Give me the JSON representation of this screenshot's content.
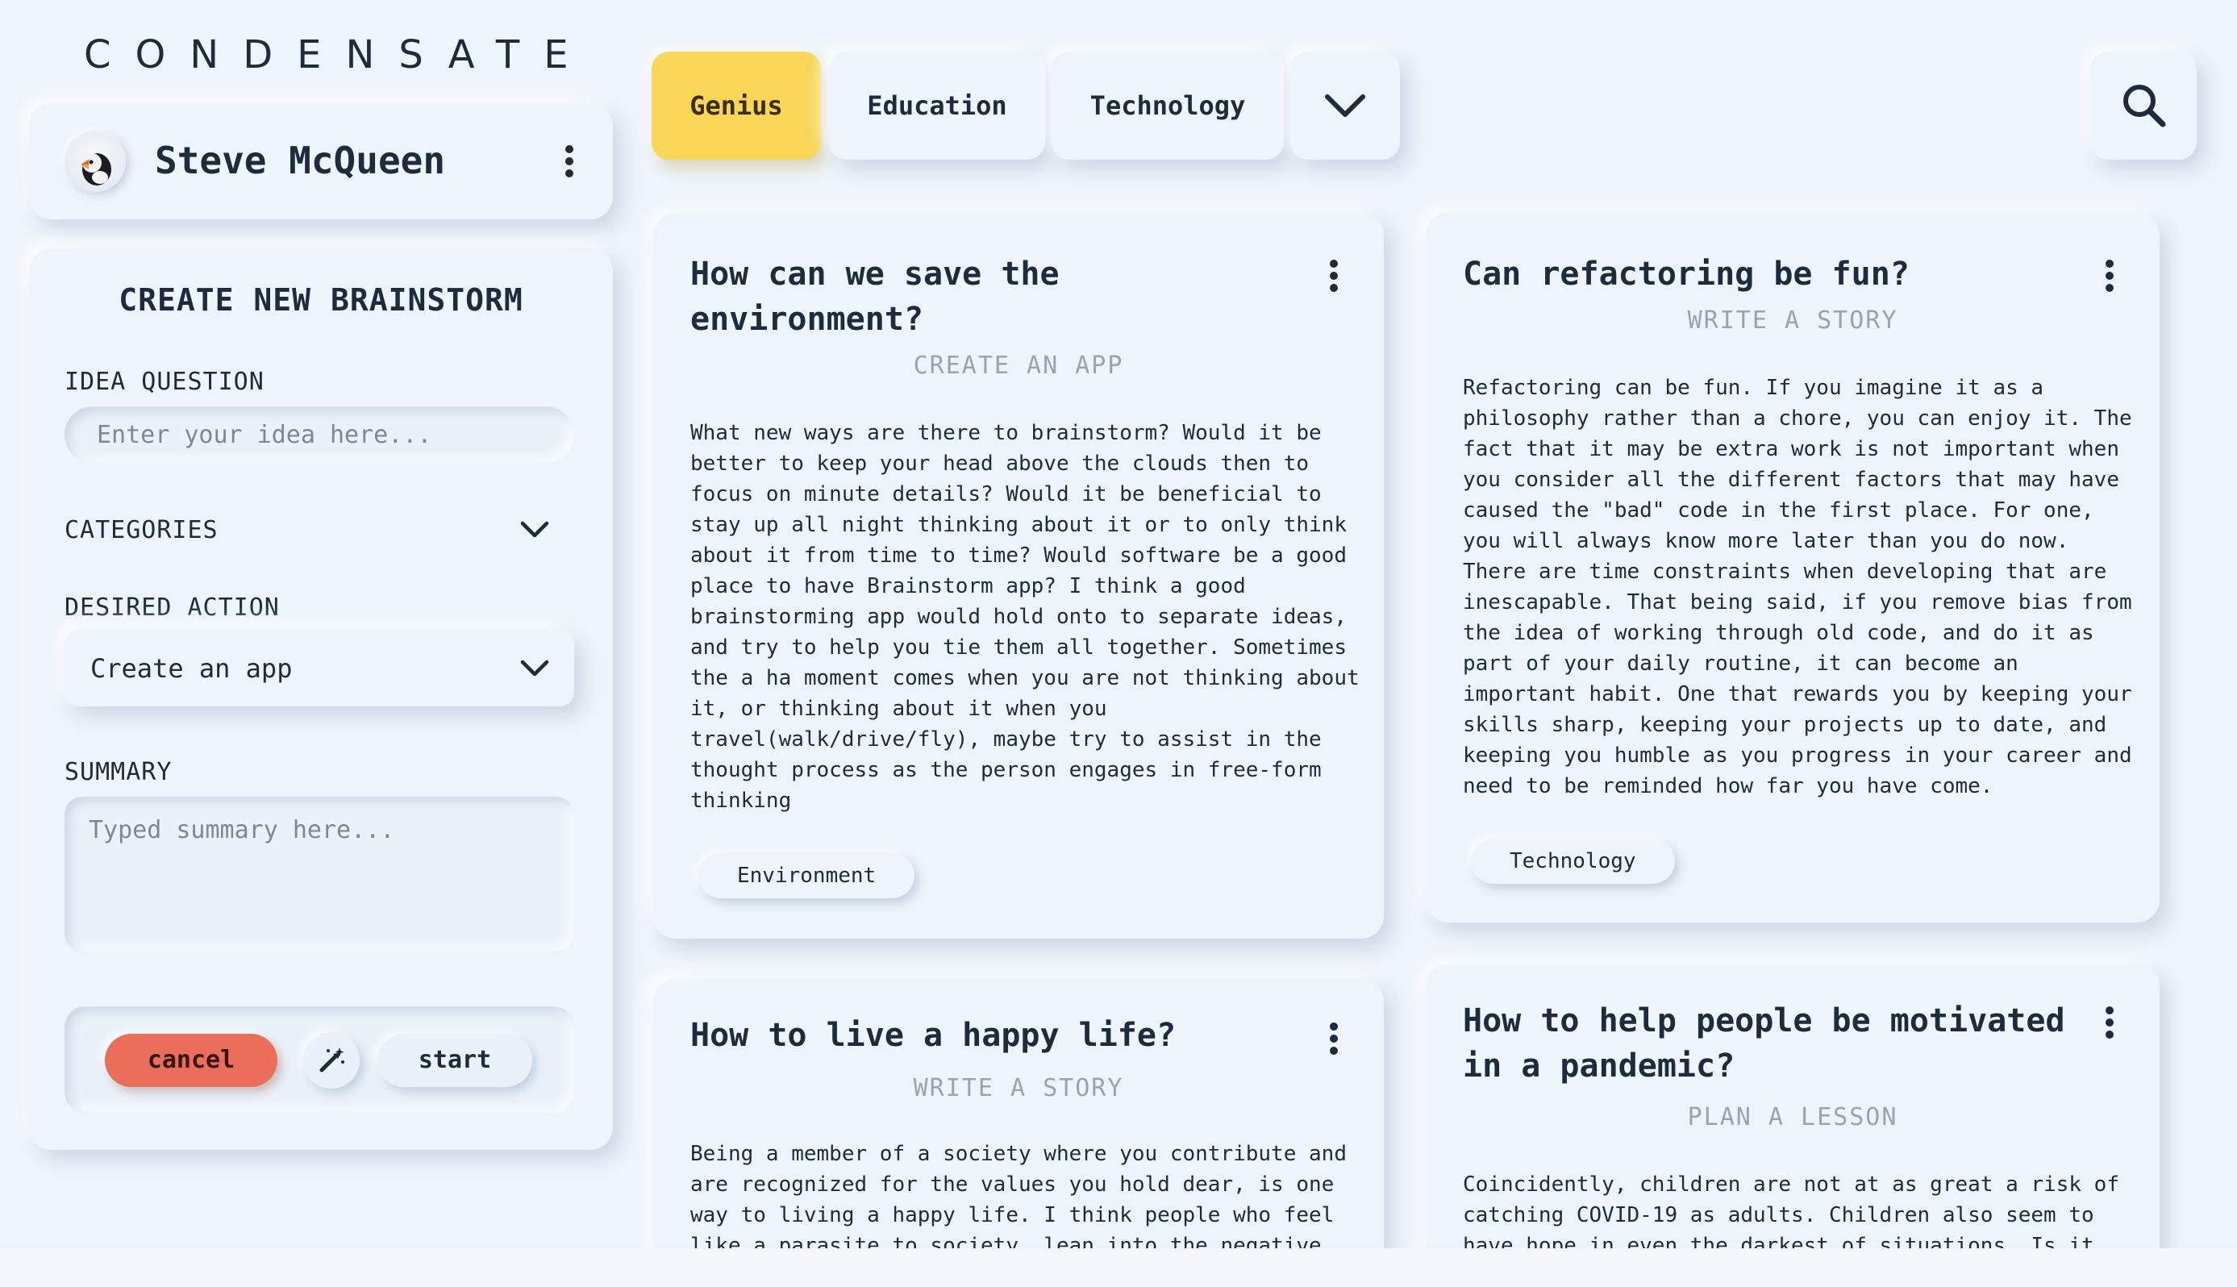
{
  "app": {
    "logo": "CONDENSATE"
  },
  "profile": {
    "name": "Steve McQueen"
  },
  "create_panel": {
    "title": "CREATE NEW BRAINSTORM",
    "idea_label": "IDEA QUESTION",
    "idea_placeholder": "Enter your idea here...",
    "categories_label": "CATEGORIES",
    "action_label": "DESIRED ACTION",
    "action_value": "Create an app",
    "summary_label": "SUMMARY",
    "summary_placeholder": "Typed summary here...",
    "cancel_label": "cancel",
    "start_label": "start"
  },
  "tabs": [
    {
      "label": "Genius",
      "active": true
    },
    {
      "label": "Education",
      "active": false
    },
    {
      "label": "Technology",
      "active": false
    }
  ],
  "cards": [
    {
      "title": "How can we save the environment?",
      "action": "CREATE AN APP",
      "body": "What new ways are there to brainstorm? Would it be better to keep your head above the clouds then to focus on minute details? Would it be beneficial to stay up all night thinking about it or to only think about it from time to time? Would software be a good place to have Brainstorm app? I think a good brainstorming app would hold onto to separate ideas, and try to help you tie them all together. Sometimes the a ha moment comes when you are not thinking about it, or thinking about it when you travel(walk/drive/fly), maybe try to assist in the thought process as the person engages in free-form thinking",
      "tag": "Environment"
    },
    {
      "title": "Can refactoring be fun?",
      "action": "WRITE A STORY",
      "body": "Refactoring can be fun. If you imagine it as a philosophy rather than a chore, you can enjoy it. The fact that it may be extra work is not important when you consider all the different factors that may have caused the \"bad\" code in the first place. For one, you will always know more later than you do now. There are time constraints when developing that are inescapable. That being said, if you remove bias from the idea of working through old code, and do it as part of your daily routine, it can become an important habit. One that rewards you by keeping your skills sharp, keeping your projects up to date, and keeping you humble as you progress in your career and need to be reminded how far you have come.",
      "tag": "Technology"
    },
    {
      "title": "How to live a happy life?",
      "action": "WRITE A STORY",
      "body": "Being a member of a society where you contribute and are recognized for the values you hold dear, is one way to living a happy life. I think people who feel like a parasite to society, lean into the negative"
    },
    {
      "title": "How to help people be motivated in a pandemic?",
      "action": "PLAN A LESSON",
      "body": "Coincidently, children are not at as great a risk of catching COVID-19 as adults. Children also seem to have hope in even the darkest of situations. Is it"
    }
  ],
  "colors": {
    "background": "#eef4fb",
    "active_tab": "#f9d657",
    "cancel_button": "#ea6e5a",
    "text": "#1c2b3e",
    "muted_text": "#9aa3ae"
  },
  "icons": [
    "puffin-avatar-icon",
    "kebab-menu-icon",
    "chevron-down-icon",
    "magic-wand-icon",
    "search-icon"
  ]
}
